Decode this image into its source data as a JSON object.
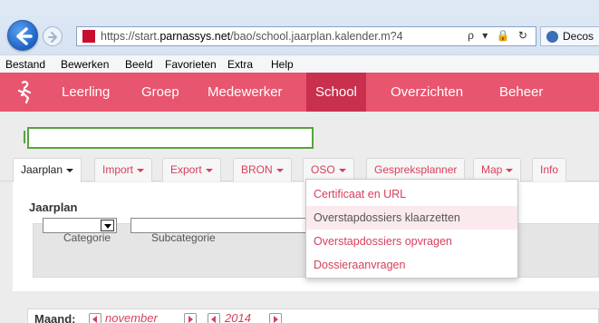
{
  "browser": {
    "url_prefix": "https://start.",
    "url_host": "parnassys.net",
    "url_path": "/bao/school.jaarplan.kalender.m?4",
    "address_tools": "ρ ▾ 🔒 ↻",
    "second_tab_label": "Decos",
    "menu": [
      "Bestand",
      "Bewerken",
      "Beeld",
      "Favorieten",
      "Extra",
      "Help"
    ]
  },
  "app_nav": {
    "items": [
      "Leerling",
      "Groep",
      "Medewerker",
      "School",
      "Overzichten",
      "Beheer"
    ],
    "active": "School",
    "accent": "#e8556e",
    "active_color": "#c8304d"
  },
  "search": {
    "value": ""
  },
  "tabs": [
    {
      "label": "Jaarplan",
      "has_caret": true
    },
    {
      "label": "Import",
      "has_caret": true
    },
    {
      "label": "Export",
      "has_caret": true
    },
    {
      "label": "BRON",
      "has_caret": true
    },
    {
      "label": "OSO",
      "has_caret": true
    },
    {
      "label": "Gespreksplanner",
      "has_caret": false
    },
    {
      "label": "Map",
      "has_caret": true
    },
    {
      "label": "Info",
      "has_caret": false
    }
  ],
  "panel": {
    "title": "Jaarplan",
    "categorie_label": "Categorie",
    "subcategorie_label": "Subcategorie",
    "categorie_value": "",
    "subcategorie_value": ""
  },
  "calendar": {
    "month_label": "Maand:",
    "month": "november",
    "year": "2014"
  },
  "oso_dropdown": {
    "items": [
      "Certificaat en URL",
      "Overstapdossiers klaarzetten",
      "Overstapdossiers opvragen",
      "Dossieraanvragen"
    ],
    "hovered": "Overstapdossiers klaarzetten"
  }
}
